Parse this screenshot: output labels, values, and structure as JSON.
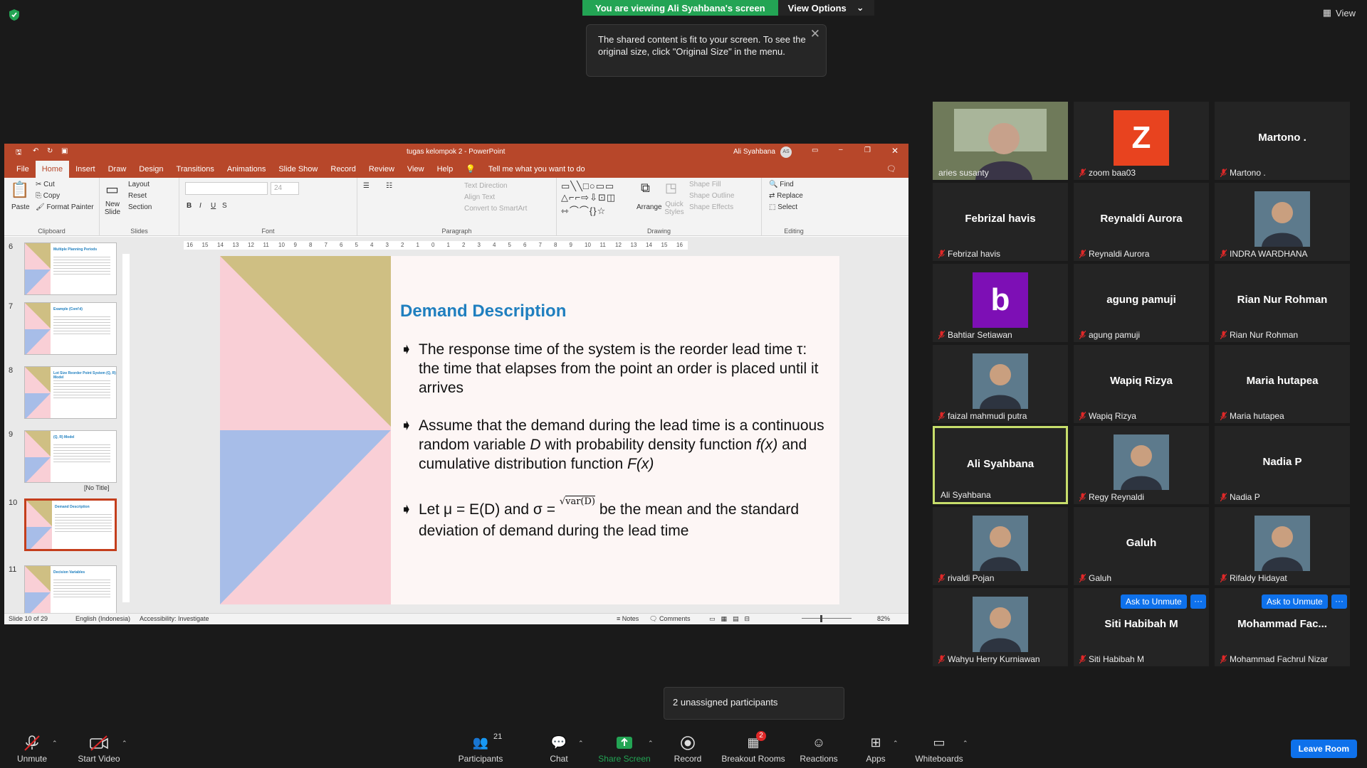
{
  "banner": {
    "viewing": "You are viewing Ali Syahbana's screen",
    "view_options": "View Options"
  },
  "tooltip": {
    "text": "The shared content is fit to your screen. To see the original size, click \"Original Size\" in the menu."
  },
  "top_right": {
    "view": "View"
  },
  "ppt": {
    "title": "tugas kelompok 2  -  PowerPoint",
    "user": "Ali Syahbana",
    "user_initials": "AS",
    "tabs": [
      "File",
      "Home",
      "Insert",
      "Draw",
      "Design",
      "Transitions",
      "Animations",
      "Slide Show",
      "Record",
      "Review",
      "View",
      "Help"
    ],
    "tell_me": "Tell me what you want to do",
    "ribbon": {
      "paste": "Paste",
      "cut": "Cut",
      "copy": "Copy",
      "format_painter": "Format Painter",
      "clipboard": "Clipboard",
      "new_slide": "New Slide",
      "layout": "Layout",
      "reset": "Reset",
      "section": "Section",
      "slides": "Slides",
      "font_size": "24",
      "font": "Font",
      "text_direction": "Text Direction",
      "align_text": "Align Text",
      "convert_smartart": "Convert to SmartArt",
      "paragraph": "Paragraph",
      "arrange": "Arrange",
      "quick_styles": "Quick Styles",
      "shape_fill": "Shape Fill",
      "shape_outline": "Shape Outline",
      "shape_effects": "Shape Effects",
      "drawing": "Drawing",
      "find": "Find",
      "replace": "Replace",
      "select": "Select",
      "editing": "Editing"
    },
    "thumbs": [
      {
        "num": "6",
        "title": "Multiple Planning Periods"
      },
      {
        "num": "7",
        "title": "Example (Cont'd)"
      },
      {
        "num": "8",
        "title": "Lot Size Reorder Point System (Q, R) Model"
      },
      {
        "num": "9",
        "title": "(Q, R) Model",
        "caption": "[No Title]"
      },
      {
        "num": "10",
        "title": "Demand Description"
      },
      {
        "num": "11",
        "title": "Decision Variables"
      }
    ],
    "ruler": [
      "16",
      "15",
      "14",
      "13",
      "12",
      "11",
      "10",
      "9",
      "8",
      "7",
      "6",
      "5",
      "4",
      "3",
      "2",
      "1",
      "0",
      "1",
      "2",
      "3",
      "4",
      "5",
      "6",
      "7",
      "8",
      "9",
      "10",
      "11",
      "12",
      "13",
      "14",
      "15",
      "16"
    ],
    "slide": {
      "title": "Demand Description",
      "b1": "The response time of the system is the reorder lead time τ: the time that elapses from the point an order is placed until it arrives",
      "b2_pre": "Assume that the demand during the lead time is a continuous random variable ",
      "b2_D": "D",
      "b2_mid": " with probability density function ",
      "b2_fx": "f(x)",
      "b2_mid2": " and cumulative distribution function ",
      "b2_Fx": "F(x)",
      "b3_pre": "Let μ = E(D) and σ = ",
      "b3_formula": "var(D)",
      "b3_post": "be the mean and the standard deviation of demand during the lead time"
    },
    "status": {
      "slide": "Slide 10 of 29",
      "lang": "English (Indonesia)",
      "access": "Accessibility: Investigate",
      "notes": "Notes",
      "comments": "Comments",
      "zoom": "82%"
    }
  },
  "participants": [
    {
      "name": "aries susanty",
      "display": "",
      "type": "video",
      "muted": false
    },
    {
      "name": "zoom baa03",
      "display": "Z",
      "type": "letter",
      "color": "#e8431f",
      "muted": true
    },
    {
      "name": "Martono .",
      "display": "Martono .",
      "type": "name",
      "muted": true
    },
    {
      "name": "Febrizal havis",
      "display": "Febrizal havis",
      "type": "name",
      "muted": true
    },
    {
      "name": "Reynaldi Aurora",
      "display": "Reynaldi Aurora",
      "type": "name",
      "muted": true
    },
    {
      "name": "INDRA WARDHANA",
      "display": "",
      "type": "photo",
      "muted": true
    },
    {
      "name": "Bahtiar Setiawan",
      "display": "b",
      "type": "letter",
      "color": "#7d0fb5",
      "muted": true
    },
    {
      "name": "agung pamuji",
      "display": "agung pamuji",
      "type": "name",
      "muted": true
    },
    {
      "name": "Rian Nur Rohman",
      "display": "Rian Nur Rohman",
      "type": "name",
      "muted": true
    },
    {
      "name": "faizal mahmudi putra",
      "display": "",
      "type": "photo",
      "muted": true
    },
    {
      "name": "Wapiq Rizya",
      "display": "Wapiq Rizya",
      "type": "name",
      "muted": true
    },
    {
      "name": "Maria hutapea",
      "display": "Maria hutapea",
      "type": "name",
      "muted": true
    },
    {
      "name": "Ali Syahbana",
      "display": "Ali Syahbana",
      "type": "name",
      "muted": false,
      "active": true
    },
    {
      "name": "Regy Reynaldi",
      "display": "",
      "type": "photo",
      "muted": true
    },
    {
      "name": "Nadia P",
      "display": "Nadia P",
      "type": "name",
      "muted": true
    },
    {
      "name": "rivaldi Pojan",
      "display": "",
      "type": "photo",
      "muted": true
    },
    {
      "name": "Galuh",
      "display": "Galuh",
      "type": "name",
      "muted": true
    },
    {
      "name": "Rifaldy Hidayat",
      "display": "",
      "type": "photo",
      "muted": true
    },
    {
      "name": "Wahyu Herry Kurniawan",
      "display": "",
      "type": "photo",
      "muted": true
    },
    {
      "name": "Siti Habibah M",
      "display": "Siti Habibah M",
      "type": "name",
      "muted": true,
      "ask": true
    },
    {
      "name": "Mohammad Fachrul Nizar",
      "display": "Mohammad  Fac...",
      "type": "name",
      "muted": true,
      "ask": true
    }
  ],
  "ask_unmute": "Ask to Unmute",
  "more": "···",
  "unassigned": "2 unassigned participants",
  "toolbar": {
    "unmute": "Unmute",
    "start_video": "Start Video",
    "participants": "Participants",
    "participants_count": "21",
    "chat": "Chat",
    "share_screen": "Share Screen",
    "record": "Record",
    "breakout": "Breakout Rooms",
    "breakout_badge": "2",
    "reactions": "Reactions",
    "apps": "Apps",
    "whiteboards": "Whiteboards",
    "leave": "Leave Room"
  }
}
